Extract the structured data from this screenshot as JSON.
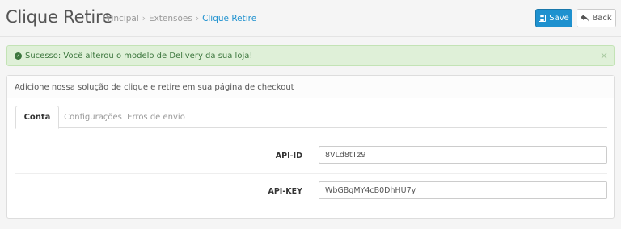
{
  "header": {
    "title": "Clique Retire",
    "breadcrumb": [
      "Principal",
      "Extensões",
      "Clique Retire"
    ],
    "save_label": "Save",
    "back_label": "Back"
  },
  "alert": {
    "message": "Sucesso: Você alterou o modelo de Delivery da sua loja!",
    "close": "×"
  },
  "panel": {
    "heading": "Adicione nossa solução de clique e retire em sua página de checkout",
    "tabs": [
      {
        "label": "Conta",
        "active": true
      },
      {
        "label": "Configurações",
        "active": false
      },
      {
        "label": "Erros de envio",
        "active": false
      }
    ],
    "fields": [
      {
        "label": "API-ID",
        "value": "8VLd8tTz9"
      },
      {
        "label": "API-KEY",
        "value": "WbGBgMY4cB0DhHU7y"
      }
    ]
  },
  "colors": {
    "primary": "#1e91cf",
    "success_bg": "#dff0d8",
    "success_text": "#3c763d"
  }
}
